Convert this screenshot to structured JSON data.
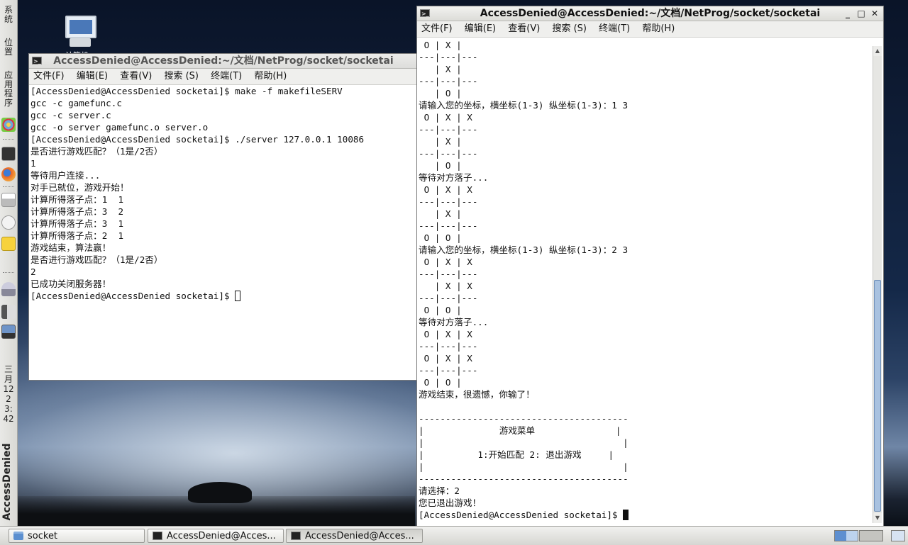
{
  "left_panel": {
    "menus": [
      "系统",
      "位置",
      "应用程序"
    ],
    "clock": "三月 12 23:42",
    "user": "AccessDenied"
  },
  "desktop": {
    "computer_label": "计算机"
  },
  "left_window": {
    "title": "AccessDenied@AccessDenied:~/文档/NetProg/socket/socketai",
    "menu": [
      "文件(F)",
      "编辑(E)",
      "查看(V)",
      "搜索 (S)",
      "终端(T)",
      "帮助(H)"
    ],
    "lines": [
      "[AccessDenied@AccessDenied socketai]$ make -f makefileSERV",
      "gcc -c gamefunc.c",
      "gcc -c server.c",
      "gcc -o server gamefunc.o server.o",
      "[AccessDenied@AccessDenied socketai]$ ./server 127.0.0.1 10086",
      "是否进行游戏匹配？（1是/2否）",
      "1",
      "等待用户连接...",
      "对手已就位，游戏开始！",
      "计算所得落子点：1  1",
      "计算所得落子点：3  2",
      "计算所得落子点：3  1",
      "计算所得落子点：2  1",
      "游戏结束，算法赢！",
      "是否进行游戏匹配？（1是/2否）",
      "2",
      "已成功关闭服务器！"
    ],
    "prompt": "[AccessDenied@AccessDenied socketai]$ "
  },
  "right_window": {
    "title": "AccessDenied@AccessDenied:~/文档/NetProg/socket/socketai",
    "menu": [
      "文件(F)",
      "编辑(E)",
      "查看(V)",
      "搜索 (S)",
      "终端(T)",
      "帮助(H)"
    ],
    "lines": [
      " O | X |",
      "---|---|---",
      "   | X |",
      "---|---|---",
      "   | O |",
      "请输入您的坐标，横坐标(1-3) 纵坐标(1-3)：1 3",
      " O | X | X",
      "---|---|---",
      "   | X |",
      "---|---|---",
      "   | O |",
      "等待对方落子...",
      " O | X | X",
      "---|---|---",
      "   | X |",
      "---|---|---",
      " O | O |",
      "请输入您的坐标，横坐标(1-3) 纵坐标(1-3)：2 3",
      " O | X | X",
      "---|---|---",
      "   | X | X",
      "---|---|---",
      " O | O |",
      "等待对方落子...",
      " O | X | X",
      "---|---|---",
      " O | X | X",
      "---|---|---",
      " O | O |",
      "游戏结束，很遗憾，你输了！",
      "",
      "---------------------------------------",
      "|              游戏菜单               |",
      "|                                     |",
      "|          1:开始匹配 2: 退出游戏     |",
      "|                                     |",
      "---------------------------------------",
      "请选择：2",
      "您已退出游戏！"
    ],
    "prompt": "[AccessDenied@AccessDenied socketai]$ "
  },
  "taskbar": {
    "items": [
      {
        "label": "socket"
      },
      {
        "label": "AccessDenied@Acces..."
      },
      {
        "label": "AccessDenied@Acces..."
      }
    ]
  },
  "colors": {
    "panel": "#e6e6e3",
    "terminal_bg": "#ffffff",
    "terminal_fg": "#111111",
    "scroll_thumb": "#a9c2e0"
  },
  "icons": [
    "computer-icon",
    "fedora-icon",
    "firefox-icon",
    "printer-icon",
    "mail-icon",
    "notes-icon",
    "network-icon",
    "volume-icon",
    "terminal-icon",
    "folder-icon"
  ]
}
